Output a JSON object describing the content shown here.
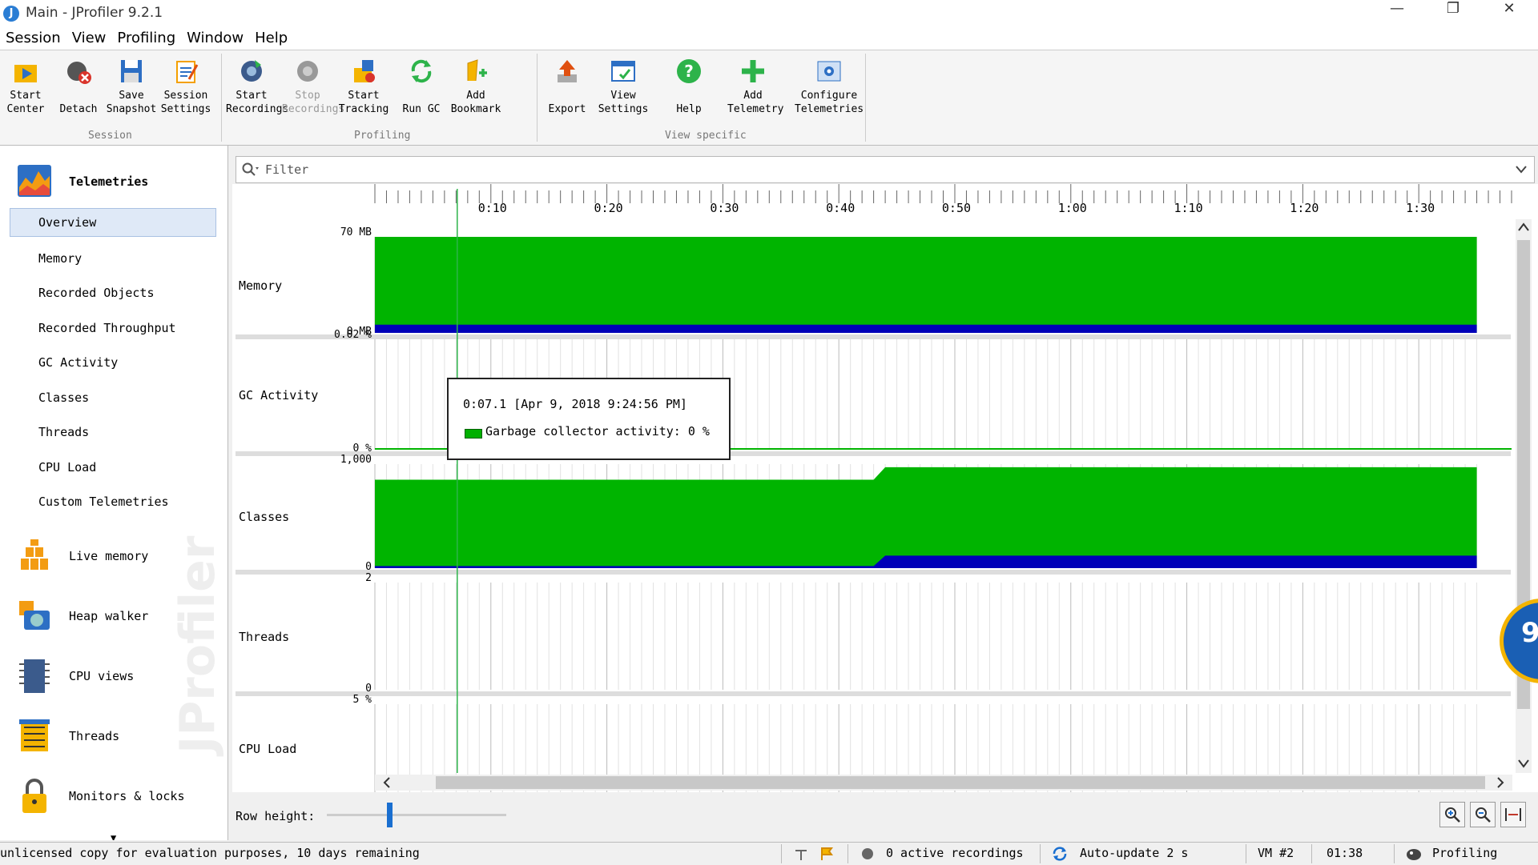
{
  "window": {
    "title": "Main - JProfiler 9.2.1",
    "controls": [
      "—",
      "❐",
      "✕"
    ]
  },
  "menu": [
    "Session",
    "View",
    "Profiling",
    "Window",
    "Help"
  ],
  "toolbar": {
    "groups": [
      {
        "label": "Session",
        "buttons": [
          {
            "line1": "Start",
            "line2": "Center",
            "icon": "start-center-icon"
          },
          {
            "line1": "",
            "line2": "Detach",
            "icon": "detach-icon"
          },
          {
            "line1": "Save",
            "line2": "Snapshot",
            "icon": "save-snapshot-icon"
          },
          {
            "line1": "Session",
            "line2": "Settings",
            "icon": "session-settings-icon"
          }
        ]
      },
      {
        "label": "Profiling",
        "buttons": [
          {
            "line1": "Start",
            "line2": "Recordings",
            "icon": "start-recordings-icon"
          },
          {
            "line1": "Stop",
            "line2": "Recordings",
            "icon": "stop-recordings-icon",
            "disabled": true
          },
          {
            "line1": "Start",
            "line2": "Tracking",
            "icon": "start-tracking-icon"
          },
          {
            "line1": "",
            "line2": "Run GC",
            "icon": "run-gc-icon"
          },
          {
            "line1": "Add",
            "line2": "Bookmark",
            "icon": "add-bookmark-icon"
          }
        ]
      },
      {
        "label": "View specific",
        "buttons": [
          {
            "line1": "",
            "line2": "Export",
            "icon": "export-icon"
          },
          {
            "line1": "View",
            "line2": "Settings",
            "icon": "view-settings-icon"
          },
          {
            "line1": "",
            "line2": "Help",
            "icon": "help-icon"
          },
          {
            "line1": "Add",
            "line2": "Telemetry",
            "icon": "add-telemetry-icon"
          },
          {
            "line1": "Configure",
            "line2": "Telemetries",
            "icon": "configure-telemetries-icon"
          }
        ]
      }
    ]
  },
  "sidebar": {
    "telemetries_label": "Telemetries",
    "sub_items": [
      "Overview",
      "Memory",
      "Recorded Objects",
      "Recorded Throughput",
      "GC Activity",
      "Classes",
      "Threads",
      "CPU Load",
      "Custom Telemetries"
    ],
    "selected": "Overview",
    "sections": [
      {
        "label": "Live memory",
        "icon": "live-memory-icon"
      },
      {
        "label": "Heap walker",
        "icon": "heap-walker-icon"
      },
      {
        "label": "CPU views",
        "icon": "cpu-views-icon"
      },
      {
        "label": "Threads",
        "icon": "threads-icon"
      },
      {
        "label": "Monitors & locks",
        "icon": "monitors-locks-icon"
      }
    ],
    "watermark": "JProfiler"
  },
  "filter": {
    "placeholder": "Filter"
  },
  "chart_data": {
    "type": "area",
    "x_unit": "elapsed time (m:ss)",
    "x_range": [
      0,
      98
    ],
    "x_tick_labels": [
      "0:10",
      "0:20",
      "0:30",
      "0:40",
      "0:50",
      "1:00",
      "1:10",
      "1:20",
      "1:30"
    ],
    "x_tick_values": [
      10,
      20,
      30,
      40,
      50,
      60,
      70,
      80,
      90
    ],
    "cursor_x": 7.1,
    "rows": [
      {
        "label": "Memory",
        "ymax_label": "70 MB",
        "ymin_label": "0 MB",
        "ymax": 70,
        "series": [
          {
            "color": "#00b400",
            "points": [
              [
                0,
                70
              ],
              [
                95,
                70
              ]
            ]
          },
          {
            "color": "#0000b8",
            "points": [
              [
                0,
                6
              ],
              [
                95,
                6
              ]
            ]
          }
        ]
      },
      {
        "label": "GC Activity",
        "ymax_label": "0.02 %",
        "ymin_label": "0 %",
        "ymax": 0.02,
        "series": [
          {
            "color": "#00b400",
            "points": [
              [
                0,
                0
              ],
              [
                95,
                0
              ]
            ]
          }
        ]
      },
      {
        "label": "Classes",
        "ymax_label": "1,000",
        "ymin_label": "0",
        "ymax": 1000,
        "series": [
          {
            "color": "#00b400",
            "points": [
              [
                0,
                850
              ],
              [
                43,
                850
              ],
              [
                44,
                970
              ],
              [
                95,
                970
              ]
            ]
          },
          {
            "color": "#0000b8",
            "points": [
              [
                0,
                20
              ],
              [
                43,
                20
              ],
              [
                44,
                120
              ],
              [
                95,
                120
              ]
            ]
          }
        ]
      },
      {
        "label": "Threads",
        "ymax_label": "2",
        "ymin_label": "0",
        "ymax": 2,
        "series": []
      },
      {
        "label": "CPU Load",
        "ymax_label": "5 %",
        "ymin_label": "",
        "ymax": 5,
        "series": []
      }
    ]
  },
  "tooltip": {
    "line1": "0:07.1 [Apr 9, 2018 9:24:56 PM]",
    "line2": "Garbage collector activity:  0 %"
  },
  "bottom": {
    "row_height_label": "Row height:",
    "row_height_fraction": 0.35
  },
  "status": {
    "license": "unlicensed copy for evaluation purposes, 10 days remaining",
    "recordings": "0 active recordings",
    "autoupdate": "Auto-update 2 s",
    "vm": "VM #2",
    "time": "01:38",
    "mode": "Profiling"
  },
  "widget": {
    "text": "9"
  },
  "colors": {
    "green": "#00b400",
    "blue": "#0000b8",
    "accent": "#1a6fd0"
  }
}
